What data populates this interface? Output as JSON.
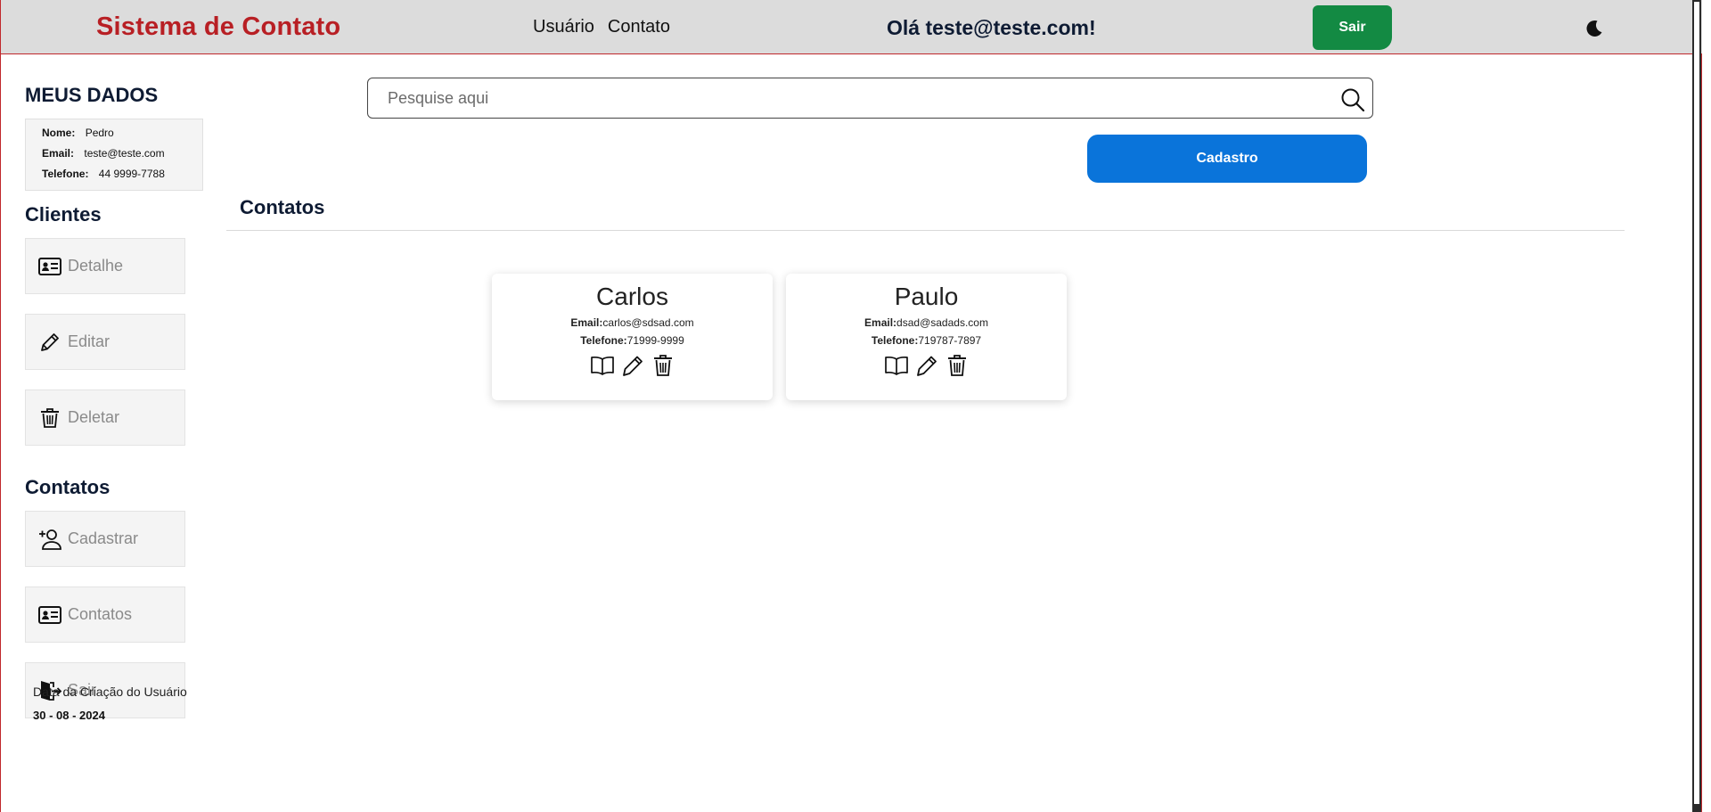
{
  "header": {
    "brand": "Sistema de Contato",
    "nav": [
      "Usuário",
      "Contato"
    ],
    "greeting": "Olá teste@teste.com!",
    "logout_label": "Sair",
    "theme_icon": "moon-icon"
  },
  "sidebar": {
    "my_data_title": "MEUS DADOS",
    "my_data": {
      "name_label": "Nome:",
      "name": "Pedro",
      "email_label": "Email:",
      "email": "teste@teste.com",
      "phone_label": "Telefone:",
      "phone": "44 9999-7788"
    },
    "clients_title": "Clientes",
    "clients_items": [
      {
        "label": "Detalhe",
        "icon": "id-card-icon"
      },
      {
        "label": "Editar",
        "icon": "pencil-icon"
      },
      {
        "label": "Deletar",
        "icon": "trash-icon"
      }
    ],
    "contacts_title": "Contatos",
    "contacts_items": [
      {
        "label": "Cadastrar",
        "icon": "person-add-icon"
      },
      {
        "label": "Contatos",
        "icon": "id-card-icon"
      },
      {
        "label": "Sair",
        "icon": "door-exit-icon"
      }
    ],
    "created_label": "Data da Criação do Usuário",
    "created_date": "30 - 08 - 2024"
  },
  "main": {
    "search_placeholder": "Pesquise aqui",
    "register_label": "Cadastro",
    "title": "Contatos",
    "cards": [
      {
        "name": "Carlos",
        "email_label": "Email:",
        "email": "carlos@sdsad.com",
        "phone_label": "Telefone:",
        "phone": "71999-9999"
      },
      {
        "name": "Paulo",
        "email_label": "Email:",
        "email": "dsad@sadads.com",
        "phone_label": "Telefone:",
        "phone": "719787-7897"
      }
    ]
  },
  "colors": {
    "brand": "#b81f24",
    "header_bg": "#dcdcdc",
    "logout_green": "#138a43",
    "primary_blue": "#0a74da",
    "heading_navy": "#0e1b33"
  }
}
